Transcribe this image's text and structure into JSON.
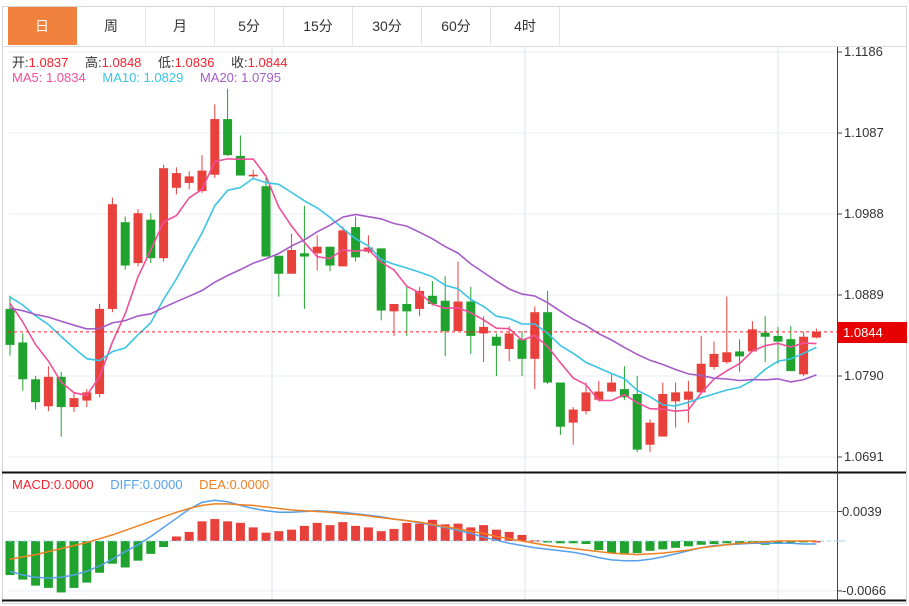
{
  "tabs": {
    "items": [
      {
        "label": "日",
        "active": true
      },
      {
        "label": "周",
        "active": false
      },
      {
        "label": "月",
        "active": false
      },
      {
        "label": "5分",
        "active": false
      },
      {
        "label": "15分",
        "active": false
      },
      {
        "label": "30分",
        "active": false
      },
      {
        "label": "60分",
        "active": false
      },
      {
        "label": "4时",
        "active": false
      }
    ]
  },
  "price_panel": {
    "ohlc": {
      "o_label": "开:",
      "o": "1.0837",
      "h_label": "高:",
      "h": "1.0848",
      "l_label": "低:",
      "l": "1.0836",
      "c_label": "收:",
      "c": "1.0844"
    },
    "ma": {
      "ma5_label": "MA5:",
      "ma5": "1.0834",
      "ma10_label": "MA10:",
      "ma10": "1.0829",
      "ma20_label": "MA20:",
      "ma20": "1.0795"
    },
    "last_price": "1.0844"
  },
  "macd_panel": {
    "macd_label": "MACD:",
    "macd": "0.0000",
    "diff_label": "DIFF:",
    "diff": "0.0000",
    "dea_label": "DEA:",
    "dea": "0.0000"
  },
  "colors": {
    "up": "#e8413c",
    "down": "#1fa32e",
    "ma5": "#f0509a",
    "ma10": "#3bc4e4",
    "ma20": "#a65cc8",
    "diff": "#55a0e8",
    "dea": "#f08021",
    "grid": "#e8eef4",
    "vgrid": "#dde6ee",
    "dotted": "#f5222d",
    "axis": "#444444",
    "badge": "#e60000",
    "tab_active": "#f0823d",
    "separator": "#111111",
    "zero_dash": "#9fd3ee"
  },
  "chart_data": {
    "type": "candlestick+macd",
    "title": "EUR daily candlestick chart with MA5/MA10/MA20 and MACD",
    "price_axis": {
      "tick_prices": [
        1.1186,
        1.1087,
        1.0988,
        1.0889,
        1.079,
        1.0691
      ],
      "tick_labels": [
        "1.1186",
        "1.1087",
        "1.0988",
        "1.0889",
        "1.0790",
        "1.0691"
      ],
      "range": [
        1.0691,
        1.1186
      ]
    },
    "macd_axis": {
      "tick_values": [
        0.0039,
        -0.0066
      ],
      "tick_labels": [
        "0.0039",
        "-0.0066"
      ],
      "zero_line": 0.0
    },
    "last_price": 1.0844,
    "legend": {
      "ohlc": {
        "open": 1.0837,
        "high": 1.0848,
        "low": 1.0836,
        "close": 1.0844
      },
      "ma5": 1.0834,
      "ma10": 1.0829,
      "ma20": 1.0795,
      "macd": 0.0,
      "diff": 0.0,
      "dea": 0.0
    },
    "candles_format": [
      "open",
      "high",
      "low",
      "close"
    ],
    "candles": [
      [
        1.0872,
        1.0888,
        1.0815,
        1.0828
      ],
      [
        1.0831,
        1.0842,
        1.0772,
        1.0786
      ],
      [
        1.0786,
        1.079,
        1.0749,
        1.0758
      ],
      [
        1.0753,
        1.0802,
        1.0747,
        1.0789
      ],
      [
        1.0789,
        1.0795,
        1.0716,
        1.0752
      ],
      [
        1.0752,
        1.077,
        1.0746,
        1.0763
      ],
      [
        1.076,
        1.0774,
        1.0752,
        1.077
      ],
      [
        1.0768,
        1.0878,
        1.0764,
        1.0872
      ],
      [
        1.0872,
        1.1008,
        1.0868,
        1.1
      ],
      [
        1.0978,
        1.0985,
        1.092,
        1.0925
      ],
      [
        1.0928,
        1.0994,
        1.0924,
        1.0989
      ],
      [
        1.0981,
        1.0989,
        1.0928,
        1.0934
      ],
      [
        1.0934,
        1.1048,
        1.093,
        1.1044
      ],
      [
        1.102,
        1.1045,
        1.1012,
        1.1038
      ],
      [
        1.1026,
        1.104,
        1.1018,
        1.1034
      ],
      [
        1.1016,
        1.106,
        1.1014,
        1.1041
      ],
      [
        1.1036,
        1.1122,
        1.1032,
        1.1104
      ],
      [
        1.1104,
        1.1141,
        1.1059,
        1.106
      ],
      [
        1.1059,
        1.1084,
        1.1035,
        1.1035
      ],
      [
        1.1035,
        1.1042,
        1.1032,
        1.1036
      ],
      [
        1.1022,
        1.1032,
        1.0936,
        1.0936
      ],
      [
        1.0937,
        1.0937,
        1.0887,
        1.0915
      ],
      [
        1.0915,
        1.0964,
        1.0915,
        1.0944
      ],
      [
        1.094,
        1.0998,
        1.0872,
        1.0936
      ],
      [
        1.094,
        1.0962,
        1.0919,
        1.0948
      ],
      [
        1.0948,
        1.0948,
        1.0918,
        1.0925
      ],
      [
        1.0924,
        1.0973,
        1.0924,
        1.0968
      ],
      [
        1.0972,
        1.0985,
        1.093,
        1.0935
      ],
      [
        1.0942,
        1.0962,
        1.094,
        1.0947
      ],
      [
        1.0946,
        1.0946,
        1.0858,
        1.087
      ],
      [
        1.0869,
        1.0878,
        1.0839,
        1.0878
      ],
      [
        1.0878,
        1.0899,
        1.0839,
        1.0869
      ],
      [
        1.0872,
        1.0899,
        1.0863,
        1.0894
      ],
      [
        1.0888,
        1.0906,
        1.0876,
        1.0878
      ],
      [
        1.0882,
        1.0912,
        1.0814,
        1.0845
      ],
      [
        1.0845,
        1.093,
        1.0845,
        1.0881
      ],
      [
        1.0881,
        1.0899,
        1.0817,
        1.0839
      ],
      [
        1.0842,
        1.0863,
        1.0807,
        1.085
      ],
      [
        1.0838,
        1.0842,
        1.079,
        1.0827
      ],
      [
        1.0823,
        1.0851,
        1.0808,
        1.0842
      ],
      [
        1.0835,
        1.0845,
        1.079,
        1.0811
      ],
      [
        1.0811,
        1.0875,
        1.0774,
        1.0868
      ],
      [
        1.0868,
        1.0894,
        1.078,
        1.0782
      ],
      [
        1.0782,
        1.0782,
        1.0718,
        1.0728
      ],
      [
        1.0733,
        1.0752,
        1.0706,
        1.0749
      ],
      [
        1.0747,
        1.0782,
        1.0743,
        1.077
      ],
      [
        1.0761,
        1.0784,
        1.0759,
        1.0771
      ],
      [
        1.0771,
        1.0792,
        1.077,
        1.0782
      ],
      [
        1.0774,
        1.0802,
        1.0761,
        1.0764
      ],
      [
        1.0768,
        1.079,
        1.0697,
        1.07
      ],
      [
        1.0706,
        1.0737,
        1.0697,
        1.0733
      ],
      [
        1.0716,
        1.0782,
        1.0716,
        1.0768
      ],
      [
        1.0759,
        1.0782,
        1.0727,
        1.077
      ],
      [
        1.0761,
        1.0784,
        1.0733,
        1.0771
      ],
      [
        1.077,
        1.0839,
        1.0768,
        1.0805
      ],
      [
        1.0801,
        1.0832,
        1.0798,
        1.0817
      ],
      [
        1.0807,
        1.0887,
        1.0805,
        1.0819
      ],
      [
        1.082,
        1.0835,
        1.0795,
        1.0814
      ],
      [
        1.082,
        1.0857,
        1.082,
        1.0847
      ],
      [
        1.0843,
        1.0863,
        1.0807,
        1.0838
      ],
      [
        1.0839,
        1.085,
        1.0805,
        1.0832
      ],
      [
        1.0835,
        1.0851,
        1.0796,
        1.0796
      ],
      [
        1.0792,
        1.0844,
        1.079,
        1.0838
      ],
      [
        1.0837,
        1.0848,
        1.0836,
        1.0844
      ]
    ],
    "seed_closes": [
      1.0845,
      1.0848,
      1.085,
      1.0852,
      1.0855,
      1.0858,
      1.086,
      1.0862,
      1.0865,
      1.0868,
      1.0875,
      1.0882,
      1.089,
      1.0896,
      1.09,
      1.0902,
      1.09,
      1.0896,
      1.089,
      1.088
    ],
    "ma_periods": [
      5,
      10,
      20
    ],
    "macd_hist": [
      -0.0045,
      -0.0051,
      -0.0059,
      -0.0062,
      -0.0068,
      -0.0062,
      -0.0055,
      -0.0042,
      -0.003,
      -0.0035,
      -0.0026,
      -0.0017,
      -0.0008,
      0.0006,
      0.0012,
      0.0026,
      0.0029,
      0.0026,
      0.0024,
      0.0018,
      0.0011,
      0.0013,
      0.0015,
      0.002,
      0.0024,
      0.0021,
      0.0025,
      0.002,
      0.0018,
      0.0013,
      0.0016,
      0.0024,
      0.0023,
      0.0028,
      0.0022,
      0.0023,
      0.0018,
      0.0021,
      0.0015,
      0.0012,
      0.0008,
      0.0001,
      -0.0002,
      -0.0003,
      -0.0003,
      -0.0004,
      -0.0012,
      -0.0016,
      -0.0018,
      -0.0016,
      -0.0013,
      -0.0011,
      -0.0009,
      -0.0007,
      -0.0005,
      -0.0004,
      -0.0003,
      -0.0003,
      -0.0004,
      -0.0005,
      -0.0003,
      -0.0002,
      -0.0001,
      0.0
    ],
    "diff_line": [
      -0.004,
      -0.0045,
      -0.0048,
      -0.0049,
      -0.0048,
      -0.0045,
      -0.004,
      -0.0033,
      -0.0024,
      -0.0014,
      -0.0005,
      0.0006,
      0.0018,
      0.003,
      0.0042,
      0.0051,
      0.0054,
      0.0052,
      0.0047,
      0.0043,
      0.004,
      0.0038,
      0.0038,
      0.0039,
      0.004,
      0.0039,
      0.0038,
      0.0036,
      0.0034,
      0.0032,
      0.0029,
      0.0027,
      0.0024,
      0.0021,
      0.0018,
      0.0014,
      0.001,
      0.0005,
      0.0001,
      -0.0003,
      -0.0006,
      -0.0009,
      -0.0011,
      -0.0013,
      -0.0015,
      -0.0018,
      -0.0022,
      -0.0025,
      -0.0026,
      -0.0026,
      -0.0024,
      -0.0021,
      -0.0017,
      -0.0013,
      -0.0009,
      -0.0006,
      -0.0005,
      -0.0004,
      -0.0003,
      -0.0003,
      -0.0003,
      -0.0003,
      -0.0004,
      -0.0004
    ],
    "dea_line": [
      -0.0024,
      -0.0021,
      -0.0018,
      -0.0014,
      -0.001,
      -0.0006,
      -0.0002,
      0.0003,
      0.0008,
      0.0014,
      0.002,
      0.0026,
      0.0032,
      0.0038,
      0.0043,
      0.0047,
      0.0049,
      0.0049,
      0.0048,
      0.0047,
      0.0045,
      0.0043,
      0.0041,
      0.004,
      0.0039,
      0.0038,
      0.0036,
      0.0035,
      0.0033,
      0.0031,
      0.0029,
      0.0027,
      0.0025,
      0.0022,
      0.0019,
      0.0016,
      0.0013,
      0.001,
      0.0006,
      0.0003,
      0.0,
      -0.0003,
      -0.0006,
      -0.0008,
      -0.001,
      -0.0012,
      -0.0014,
      -0.0016,
      -0.0017,
      -0.0018,
      -0.0017,
      -0.0016,
      -0.0014,
      -0.0012,
      -0.0009,
      -0.0007,
      -0.0005,
      -0.0003,
      -0.0002,
      -0.0001,
      0.0,
      0.0,
      0.0,
      0.0
    ]
  }
}
